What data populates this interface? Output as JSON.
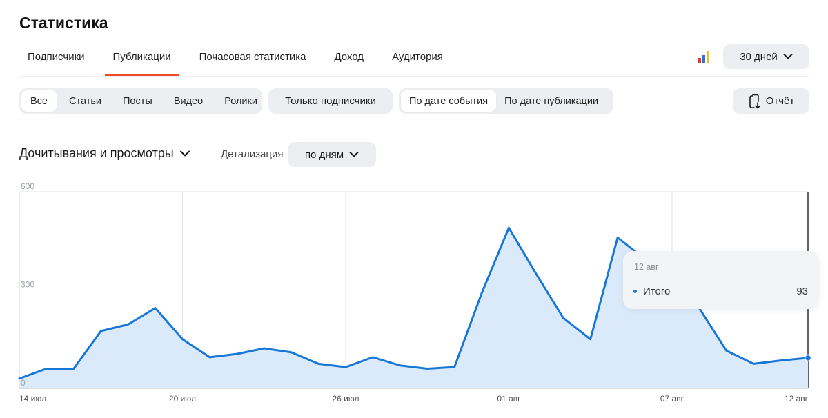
{
  "page": {
    "title": "Статистика"
  },
  "tabs": [
    {
      "label": "Подписчики",
      "active": false
    },
    {
      "label": "Публикации",
      "active": true
    },
    {
      "label": "Почасовая статистика",
      "active": false
    },
    {
      "label": "Доход",
      "active": false
    },
    {
      "label": "Аудитория",
      "active": false
    }
  ],
  "period": {
    "label": "30 дней"
  },
  "content_types": [
    "Все",
    "Статьи",
    "Посты",
    "Видео",
    "Ролики"
  ],
  "subscribers_only_label": "Только подписчики",
  "date_modes": [
    "По дате события",
    "По дате публикации"
  ],
  "report_label": "Отчёт",
  "metric": {
    "label": "Дочитывания и просмотры"
  },
  "detail": {
    "label": "Детализация",
    "value": "по дням"
  },
  "tooltip": {
    "date": "12 авг",
    "label": "Итого",
    "value": "93"
  },
  "colors": {
    "accent": "#ef4b2b",
    "line": "#1777d6",
    "fill": "#dbeafb"
  },
  "chart_data": {
    "type": "area",
    "x": [
      "14 июл",
      "15 июл",
      "16 июл",
      "17 июл",
      "18 июл",
      "19 июл",
      "20 июл",
      "21 июл",
      "22 июл",
      "23 июл",
      "24 июл",
      "25 июл",
      "26 июл",
      "27 июл",
      "28 июл",
      "29 июл",
      "30 июл",
      "31 июл",
      "01 авг",
      "02 авг",
      "03 авг",
      "04 авг",
      "05 авг",
      "06 авг",
      "07 авг",
      "08 авг",
      "09 авг",
      "10 авг",
      "11 авг",
      "12 авг"
    ],
    "series": [
      {
        "name": "Итого",
        "values": [
          30,
          60,
          60,
          175,
          195,
          245,
          150,
          95,
          105,
          122,
          110,
          75,
          65,
          95,
          70,
          60,
          65,
          290,
          490,
          350,
          215,
          150,
          460,
          395,
          280,
          245,
          115,
          75,
          85,
          93
        ]
      }
    ],
    "xticks": [
      "14 июл",
      "20 июл",
      "26 июл",
      "01 авг",
      "07 авг",
      "12 авг"
    ],
    "yticks": [
      0,
      300,
      600
    ],
    "ylim": [
      0,
      600
    ],
    "grid": true
  }
}
